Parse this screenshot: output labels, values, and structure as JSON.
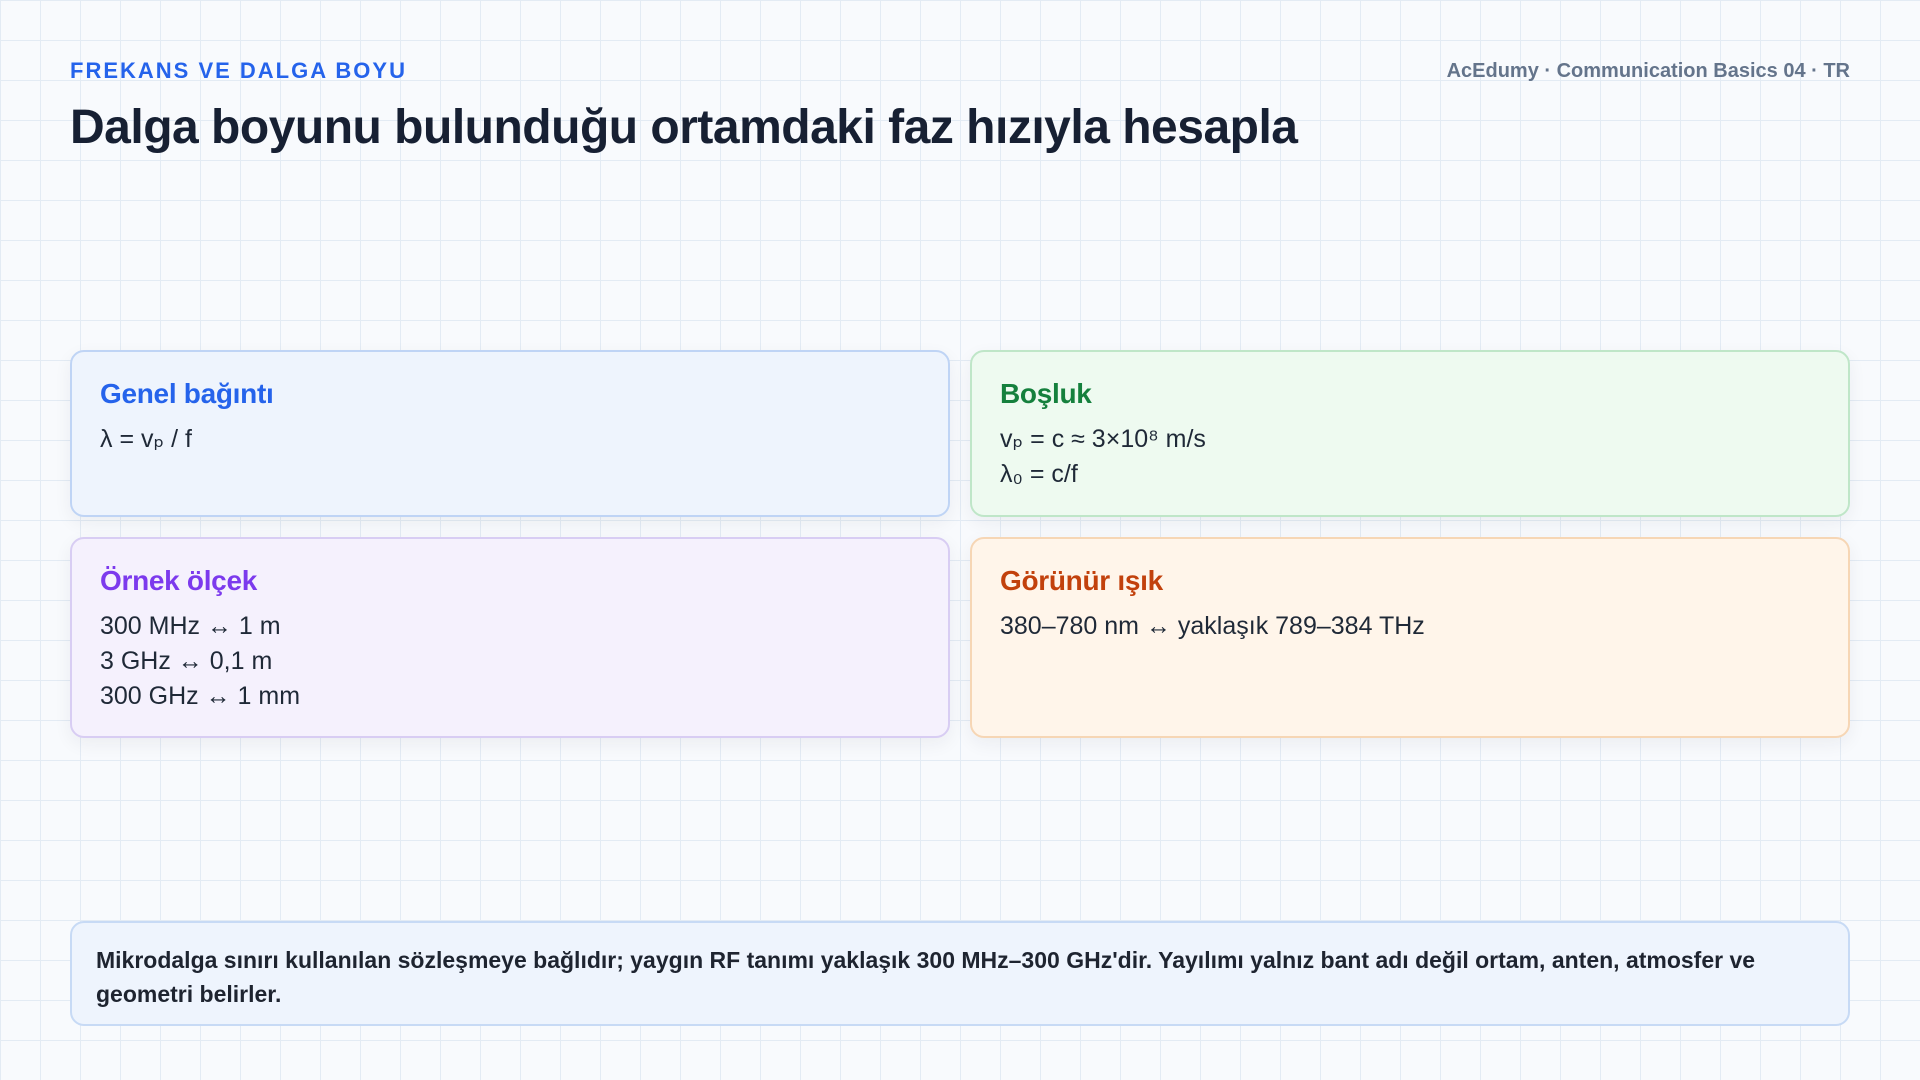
{
  "header": {
    "eyebrow": "FREKANS VE DALGA BOYU",
    "brand": "AcEdumy · Communication Basics 04 · TR",
    "title": "Dalga boyunu bulunduğu ortamdaki faz hızıyla hesapla"
  },
  "cards": [
    {
      "heading": "Genel bağıntı",
      "lines": [
        "λ = vₚ / f"
      ],
      "accent": "#2563eb"
    },
    {
      "heading": "Boşluk",
      "lines": [
        "vₚ = c ≈ 3×10⁸ m/s",
        "λ₀ = c/f"
      ],
      "accent": "#15803d"
    },
    {
      "heading": "Örnek ölçek",
      "lines": [
        "300 MHz ↔ 1 m",
        "3 GHz ↔ 0,1 m",
        "300 GHz ↔ 1 mm"
      ],
      "accent": "#7c3aed"
    },
    {
      "heading": "Görünür ışık",
      "lines": [
        "380–780 nm ↔ yaklaşık 789–384 THz"
      ],
      "accent": "#c2410c"
    }
  ],
  "note": {
    "text": "Mikrodalga sınırı kullanılan sözleşmeye bağlıdır; yaygın RF tanımı yaklaşık 300 MHz–300 GHz'dir. Yayılımı yalnız bant adı değil ortam, anten, atmosfer ve geometri belirler."
  }
}
